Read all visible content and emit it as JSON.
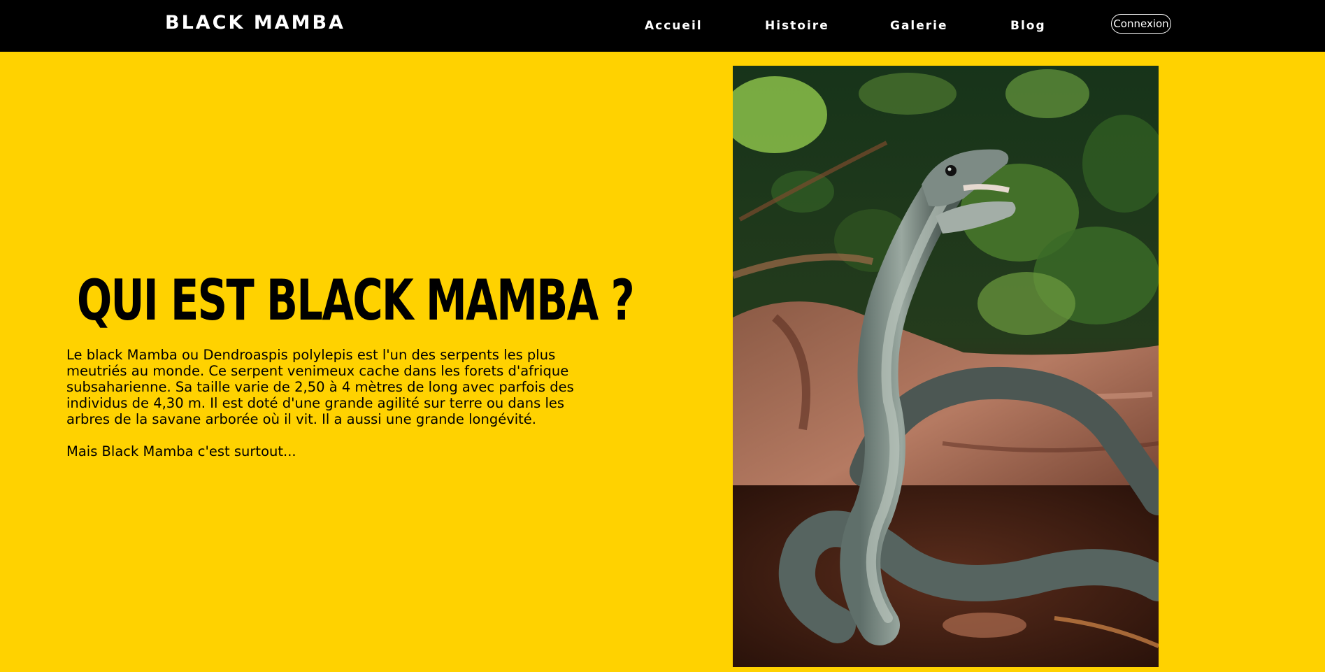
{
  "header": {
    "logo": "BLACK MAMBA",
    "nav": [
      "Accueil",
      "Histoire",
      "Galerie",
      "Blog"
    ],
    "login_label": "Connexion"
  },
  "hero": {
    "title": "QUI EST BLACK MAMBA ?",
    "paragraph": "Le black Mamba ou Dendroaspis polylepis est l'un des serpents les plus meutriés au monde. Ce serpent venimeux cache dans les forets d'afrique subsaharienne. Sa taille varie de 2,50 à 4 mètres de long avec parfois des individus de 4,30 m. Il est doté d'une grande agilité sur terre ou dans les arbres de la savane arborée où il vit. Il a aussi une grande longévité.",
    "tagline": "Mais Black Mamba c'est surtout..."
  },
  "colors": {
    "background": "#ffd200",
    "header": "#000000",
    "text": "#000000",
    "nav_text": "#ffffff"
  }
}
